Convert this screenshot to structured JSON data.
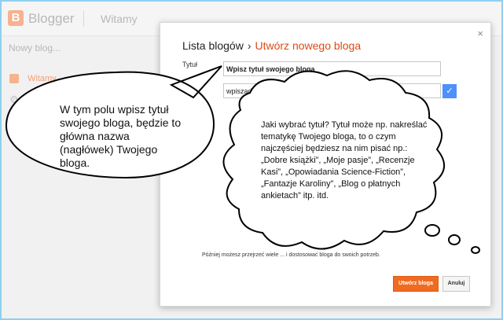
{
  "header": {
    "logo": "B",
    "brand": "Blogger",
    "welcome": "Witamy"
  },
  "sidebar": {
    "new_blog": "Nowy blog...",
    "item_label": "Witamy",
    "gear": "⚙"
  },
  "dialog": {
    "close": "×",
    "breadcrumb_root": "Lista blogów",
    "breadcrumb_sep": "›",
    "breadcrumb_current": "Utwórz nowego bloga",
    "title_label": "Tytuł",
    "title_value": "Wpisz tytuł swojego bloga",
    "address_value": "wpiszad",
    "check": "✓",
    "hint": "Później możesz przejrzeć wiele ... i dostosować bloga do swoich potrzeb.",
    "create_button": "Utwórz bloga",
    "cancel_button": "Anuluj"
  },
  "callout_oval": "W tym polu wpisz tytuł swojego bloga, będzie to główna nazwa (nagłówek) Twojego bloga.",
  "callout_cloud": "Jaki wybrać tytuł? Tytuł może np. nakreślać tematykę Twojego bloga, to o czym najczęściej będziesz na nim pisać np.: „Dobre książki”, „Moje pasje”, „Recenzje Kasi”, „Opowiadania Science-Fiction”, „Fantazje Karoliny”, „Blog o płatnych ankietach” itp. itd."
}
